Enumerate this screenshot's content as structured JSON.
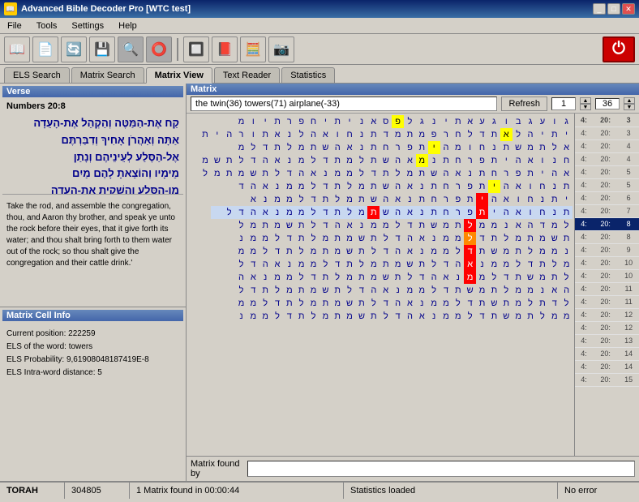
{
  "titlebar": {
    "title": "Advanced Bible Decoder Pro [WTC test]",
    "icon": "📖",
    "min_label": "_",
    "max_label": "□",
    "close_label": "✕"
  },
  "menu": {
    "items": [
      "File",
      "Tools",
      "Settings",
      "Help"
    ]
  },
  "toolbar": {
    "buttons": [
      "📖",
      "📄",
      "🔄",
      "💾",
      "🔍",
      "⭕",
      "🔲",
      "📕",
      "🧮",
      "📷"
    ],
    "power_label": "⏻"
  },
  "tabs": [
    {
      "id": "els",
      "label": "ELS Search"
    },
    {
      "id": "matrix",
      "label": "Matrix Search"
    },
    {
      "id": "view",
      "label": "Matrix View",
      "active": true
    },
    {
      "id": "reader",
      "label": "Text Reader"
    },
    {
      "id": "stats",
      "label": "Statistics"
    }
  ],
  "verse": {
    "header": "Verse",
    "ref": "Numbers 20:8",
    "text_he": "קַח אֶת-הַמַּטֶּה וְהַקְהֵל אֶת-הָעֵדָה\nאַתָּה וְאַהֲרֹן אָחִיךָ וְדִבַּרְתֶּם\nאֶל-הַסֶּלַע לְעֵינֵיהֶם וְנָתַן\nמֵימָיו וְהוֹצֵאתָ לָהֶם מַיִם\nמִן-הַסֶּלַע וְהִשְׁקִיתָ אֶת-הָעֵדָה\nוְאֶת-בְּעִירָם:",
    "text_en": "Take the rod, and assemble the congregation, thou, and Aaron thy brother, and speak ye unto the rock before their eyes, that it give forth its water; and thou shalt bring forth to them water out of the rock; so thou shalt give the congregation and their cattle drink.'"
  },
  "cell_info": {
    "header": "Matrix Cell Info",
    "position_label": "Current position:",
    "position_value": "222259",
    "els_label": "ELS of the word:",
    "els_value": "towers",
    "prob_label": "ELS Probability:",
    "prob_value": "9,61908048187419E-8",
    "dist_label": "ELS Intra-word distance:",
    "dist_value": "5"
  },
  "matrix": {
    "header": "Matrix",
    "description": "the twin(36) towers(71) airplane(-33)",
    "refresh_label": "Refresh",
    "num_value": "1",
    "spin_up": "▲",
    "spin_down": "▼",
    "num2_value": "36",
    "found_by_label": "Matrix found by",
    "found_by_value": ""
  },
  "right_sidebar": {
    "rows": [
      {
        "ref": "4:",
        "book": "20:",
        "num": "3"
      },
      {
        "ref": "4:",
        "book": "20:",
        "num": "4"
      },
      {
        "ref": "4:",
        "book": "20:",
        "num": "4"
      },
      {
        "ref": "4:",
        "book": "20:",
        "num": "5"
      },
      {
        "ref": "4:",
        "book": "20:",
        "num": "5"
      },
      {
        "ref": "4:",
        "book": "20:",
        "num": "6"
      },
      {
        "ref": "4:",
        "book": "20:",
        "num": "7"
      },
      {
        "ref": "4:",
        "book": "20:",
        "num": "8",
        "selected": true
      },
      {
        "ref": "4:",
        "book": "20:",
        "num": "8"
      },
      {
        "ref": "4:",
        "book": "20:",
        "num": "9"
      },
      {
        "ref": "4:",
        "book": "20:",
        "num": "10"
      },
      {
        "ref": "4:",
        "book": "20:",
        "num": "10"
      },
      {
        "ref": "4:",
        "book": "20:",
        "num": "11"
      },
      {
        "ref": "4:",
        "book": "20:",
        "num": "11"
      },
      {
        "ref": "4:",
        "book": "20:",
        "num": "12"
      },
      {
        "ref": "4:",
        "book": "20:",
        "num": "12"
      },
      {
        "ref": "4:",
        "book": "20:",
        "num": "13"
      },
      {
        "ref": "4:",
        "book": "20:",
        "num": "14"
      },
      {
        "ref": "4:",
        "book": "20:",
        "num": "14"
      },
      {
        "ref": "4:",
        "book": "20:",
        "num": "15"
      }
    ]
  },
  "statusbar": {
    "torah": "TORAH",
    "count": "304805",
    "matrix_found": "1 Matrix found in 00:00:44",
    "stats": "Statistics loaded",
    "error": "No error"
  },
  "matrix_grid": {
    "rows": [
      [
        "ג",
        "ו",
        "ע",
        "ג",
        "ב",
        "ו",
        "ג",
        "ע",
        "א",
        "ת",
        "י",
        "נ",
        "ג",
        "ל",
        "פ",
        "ס",
        "א",
        "נ",
        "י",
        "ת",
        "י",
        "ח",
        "פ",
        "ר",
        "ת",
        "י",
        "ו",
        "מ"
      ],
      [
        "י",
        "ת",
        "י",
        "ה",
        "ל",
        "א",
        "ת",
        "ד",
        "ל",
        "ח",
        "ר",
        "פ",
        "ת",
        "מ",
        "ד",
        "ל",
        "ח",
        "ר",
        "ת",
        "ש",
        "מ",
        "ל",
        "א",
        "ת",
        "נ",
        "ח",
        "ו",
        "א",
        "ה",
        "י",
        "ת"
      ],
      [
        "א",
        "ל",
        "ת",
        "מ",
        "ש",
        "ת",
        "נ",
        "ח",
        "ו",
        "א",
        "ה",
        "י",
        "ת",
        "פ",
        "ר",
        "ח",
        "ת",
        "נ",
        "א",
        "ה",
        "ש",
        "ת",
        "מ",
        "ל",
        "ת",
        "ד",
        "ל",
        "מ"
      ],
      [
        "ח",
        "נ",
        "ו",
        "א",
        "ה",
        "י",
        "ת",
        "פ",
        "ר",
        "ח",
        "ת",
        "נ",
        "א",
        "ה",
        "ש",
        "ת",
        "מ",
        "ל",
        "ת",
        "ד",
        "ל",
        "מ",
        "מ",
        "נ",
        "א",
        "ה",
        "ד",
        "ל",
        "ת",
        "ש",
        "מ"
      ],
      [
        "א",
        "ה",
        "י",
        "ת",
        "פ",
        "ר",
        "ח",
        "ת",
        "נ",
        "א",
        "ה",
        "ש",
        "ת",
        "מ",
        "ל",
        "ת",
        "ד",
        "ל",
        "מ",
        "מ",
        "נ",
        "א",
        "ה",
        "ד",
        "ל",
        "ת",
        "ש",
        "מ",
        "ת",
        "מ",
        "ל"
      ],
      [
        "ת",
        "נ",
        "ח",
        "ו",
        "א",
        "ה",
        "י",
        "ת",
        "פ",
        "ר",
        "ח",
        "ת",
        "נ",
        "א",
        "ה",
        "ש",
        "ת",
        "מ",
        "ל",
        "ת",
        "ד",
        "ל",
        "מ",
        "מ",
        "נ",
        "א",
        "ה",
        "ד"
      ],
      [
        "י",
        "ת",
        "נ",
        "ח",
        "ו",
        "א",
        "ה",
        "י",
        "ת",
        "פ",
        "ר",
        "ח",
        "ת",
        "נ",
        "א",
        "ה",
        "ש",
        "ת",
        "מ",
        "ל",
        "ת",
        "ד",
        "ל",
        "מ",
        "מ",
        "נ",
        "א"
      ],
      [
        "ת",
        "נ",
        "ח",
        "ו",
        "א",
        "ה",
        "י",
        "ת",
        "פ",
        "ר",
        "ח",
        "ת",
        "נ",
        "א",
        "ה",
        "ש",
        "ת",
        "מ",
        "ל",
        "ת",
        "ד",
        "ל",
        "מ",
        "מ",
        "נ",
        "א",
        "ה",
        "ד",
        "ל"
      ],
      [
        "ל",
        "מ",
        "ד",
        "ה",
        "א",
        "נ",
        "מ",
        "מ",
        "ל",
        "ת",
        "מ",
        "ש",
        "ת",
        "ד",
        "ל",
        "מ",
        "מ",
        "נ",
        "א",
        "ה",
        "ד",
        "ל",
        "ת",
        "ש",
        "מ",
        "ת",
        "מ",
        "ל"
      ],
      [
        "ת",
        "ש",
        "מ",
        "ת",
        "מ",
        "ל",
        "ת",
        "ד",
        "ל",
        "מ",
        "מ",
        "נ",
        "א",
        "ה",
        "ד",
        "ל",
        "ת",
        "ש",
        "מ",
        "ת",
        "מ",
        "ל",
        "ת",
        "ד",
        "ל",
        "מ",
        "מ",
        "נ"
      ],
      [
        "נ",
        "מ",
        "מ",
        "ל",
        "ת",
        "מ",
        "ש",
        "ת",
        "ד",
        "ל",
        "מ",
        "מ",
        "נ",
        "א",
        "ה",
        "ד",
        "ל",
        "ת",
        "ש",
        "מ",
        "ת",
        "מ",
        "ל",
        "ת",
        "ד",
        "ל",
        "מ",
        "מ"
      ],
      [
        "מ",
        "ל",
        "ת",
        "ד",
        "ל",
        "מ",
        "מ",
        "נ",
        "א",
        "ה",
        "ד",
        "ל",
        "ת",
        "ש",
        "מ",
        "ת",
        "מ",
        "ל",
        "ת",
        "ד",
        "ל",
        "מ",
        "מ",
        "נ",
        "א",
        "ה",
        "ד",
        "ל"
      ],
      [
        "ל",
        "ת",
        "מ",
        "ש",
        "ת",
        "ד",
        "ל",
        "מ",
        "מ",
        "נ",
        "א",
        "ה",
        "ד",
        "ל",
        "ת",
        "ש",
        "מ",
        "ת",
        "מ",
        "ל",
        "ת",
        "ד",
        "ל",
        "מ",
        "מ",
        "נ",
        "א",
        "ה"
      ],
      [
        "ה",
        "א",
        "נ",
        "מ",
        "מ",
        "ל",
        "ת",
        "מ",
        "ש",
        "ת",
        "ד",
        "ל",
        "מ",
        "מ",
        "נ",
        "א",
        "ה",
        "ד",
        "ל",
        "ת",
        "ש",
        "מ",
        "ת",
        "מ",
        "ל",
        "ת",
        "ד",
        "ל"
      ],
      [
        "ל",
        "ד",
        "ת",
        "ל",
        "מ",
        "ת",
        "ש",
        "ת",
        "ד",
        "ל",
        "מ",
        "מ",
        "נ",
        "א",
        "ה",
        "ד",
        "ל",
        "ת",
        "ש",
        "מ",
        "ת",
        "מ",
        "ל",
        "ת",
        "ד",
        "ל",
        "מ",
        "מ"
      ],
      [
        "מ",
        "מ",
        "ל",
        "ת",
        "מ",
        "ש",
        "ת",
        "ד",
        "ל",
        "מ",
        "מ",
        "נ",
        "א",
        "ה",
        "ד",
        "ל",
        "ת",
        "ש",
        "מ",
        "ת",
        "מ",
        "ל",
        "ת",
        "ד",
        "ל",
        "מ",
        "מ",
        "נ"
      ]
    ]
  }
}
